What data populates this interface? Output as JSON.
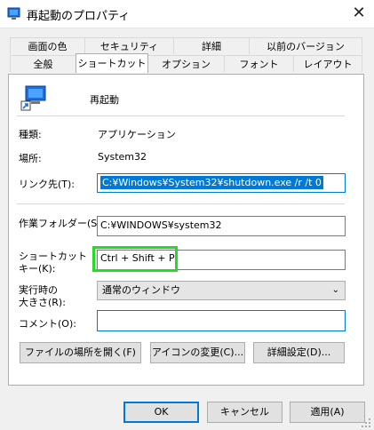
{
  "window": {
    "title": "再起動のプロパティ",
    "close_glyph": "✕"
  },
  "tabs_back": [
    "画面の色",
    "セキュリティ",
    "詳細",
    "以前のバージョン"
  ],
  "tabs_front": [
    "全般",
    "ショートカット",
    "オプション",
    "フォント",
    "レイアウト"
  ],
  "active_tab": "ショートカット",
  "shortcut": {
    "name": "再起動",
    "type_label": "種類:",
    "type_value": "アプリケーション",
    "location_label": "場所:",
    "location_value": "System32",
    "target_label": "リンク先(T):",
    "target_value": "C:¥Windows¥System32¥shutdown.exe /r /t 0",
    "startin_label": "作業フォルダー(S):",
    "startin_value": "C:¥WINDOWS¥system32",
    "hotkey_label_1": "ショートカット",
    "hotkey_label_2": "キー(K):",
    "hotkey_value": "Ctrl + Shift + P",
    "run_label_1": "実行時の",
    "run_label_2": "大きさ(R):",
    "run_value": "通常のウィンドウ",
    "comment_label": "コメント(O):",
    "comment_value": ""
  },
  "buttons": {
    "open_location": "ファイルの場所を開く(F)",
    "change_icon": "アイコンの変更(C)...",
    "advanced": "詳細設定(D)...",
    "ok": "OK",
    "cancel": "キャンセル",
    "apply": "適用(A)"
  },
  "colors": {
    "accent": "#0078d7",
    "highlight": "#22dd22"
  }
}
